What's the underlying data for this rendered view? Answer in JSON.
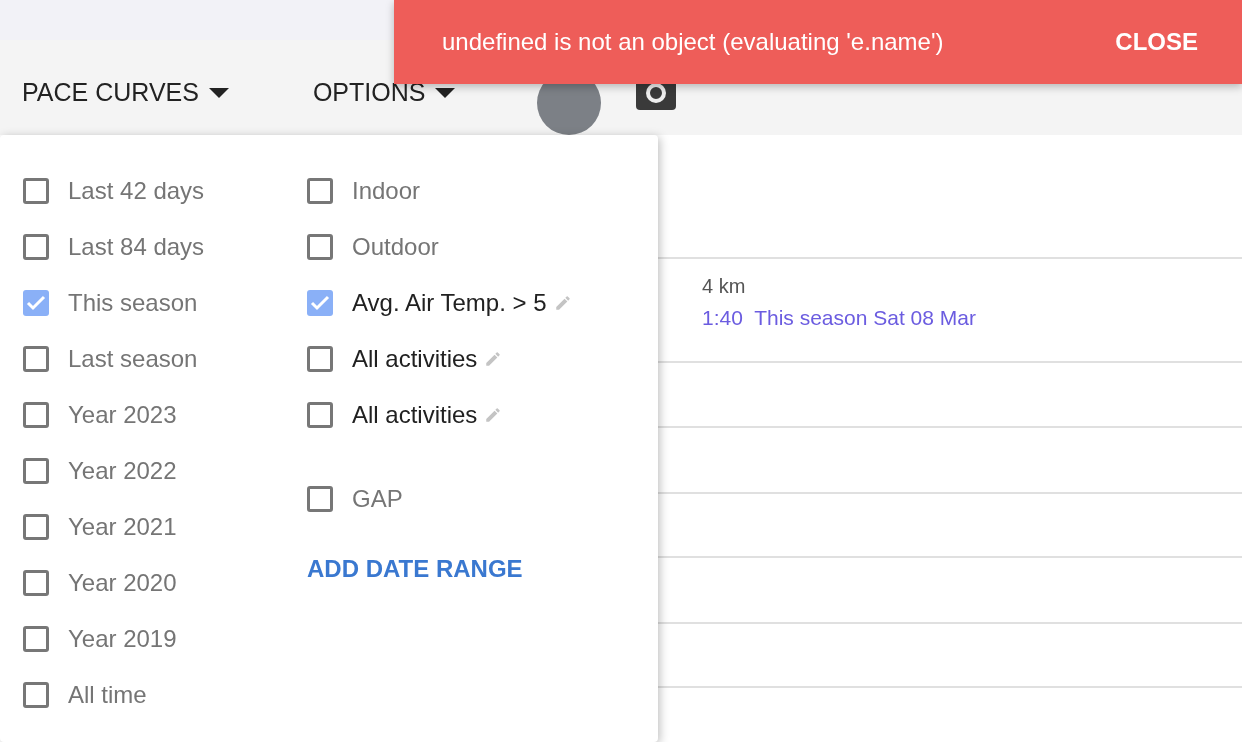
{
  "toolbar": {
    "menus": [
      {
        "label": "PACE CURVES"
      },
      {
        "label": "OPTIONS"
      }
    ]
  },
  "toast": {
    "message": "undefined is not an object (evaluating 'e.name')",
    "action": "CLOSE"
  },
  "dropdown": {
    "left": [
      {
        "label": "Last 42 days",
        "checked": false
      },
      {
        "label": "Last 84 days",
        "checked": false
      },
      {
        "label": "This season",
        "checked": true
      },
      {
        "label": "Last season",
        "checked": false
      },
      {
        "label": "Year 2023",
        "checked": false
      },
      {
        "label": "Year 2022",
        "checked": false
      },
      {
        "label": "Year 2021",
        "checked": false
      },
      {
        "label": "Year 2020",
        "checked": false
      },
      {
        "label": "Year 2019",
        "checked": false
      },
      {
        "label": "All time",
        "checked": false
      }
    ],
    "right": [
      {
        "kind": "plain",
        "label": "Indoor",
        "checked": false
      },
      {
        "kind": "plain",
        "label": "Outdoor",
        "checked": false
      },
      {
        "kind": "editable",
        "label": "Avg. Air Temp. > 5",
        "checked": true
      },
      {
        "kind": "editable",
        "label": "All activities",
        "checked": false
      },
      {
        "kind": "editable",
        "label": "All activities",
        "checked": false
      },
      {
        "kind": "spacer"
      },
      {
        "kind": "plain",
        "label": "GAP",
        "checked": false
      }
    ],
    "add_link": "ADD DATE RANGE"
  },
  "chart": {
    "distance": "4 km",
    "tooltip": {
      "time": "1:40",
      "series": "This season",
      "date": "Sat 08 Mar"
    }
  }
}
